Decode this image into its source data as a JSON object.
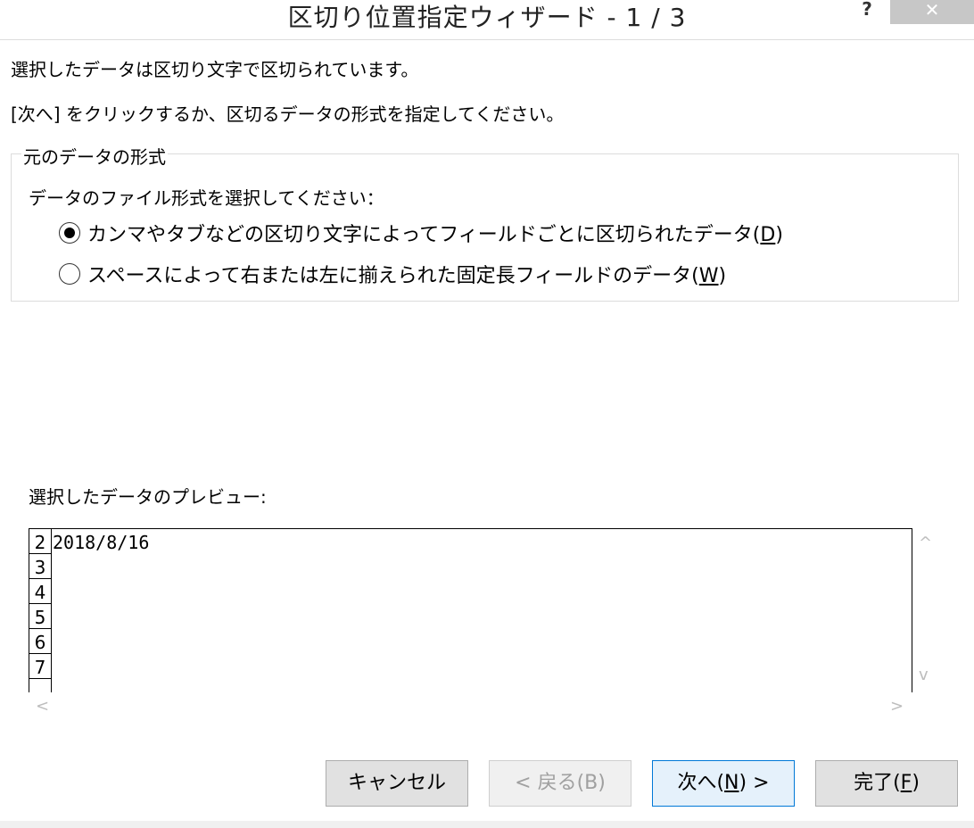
{
  "window": {
    "title": "区切り位置指定ウィザード - 1 / 3",
    "help_label": "?",
    "close_label": "✕"
  },
  "intro": {
    "line1": "選択したデータは区切り文字で区切られています。",
    "line2": "[次へ] をクリックするか、区切るデータの形式を指定してください。"
  },
  "format_group": {
    "legend": "元のデータの形式",
    "prompt": "データのファイル形式を選択してください：",
    "options": [
      {
        "label_pre": "カンマやタブなどの区切り文字によってフィールドごとに区切られたデータ(",
        "accel": "D",
        "label_post": ")",
        "selected": true
      },
      {
        "label_pre": "スペースによって右または左に揃えられた固定長フィールドのデータ(",
        "accel": "W",
        "label_post": ")",
        "selected": false
      }
    ]
  },
  "preview": {
    "label": "選択したデータのプレビュー:",
    "rows": [
      {
        "num": "2",
        "text": "2018/8/16"
      },
      {
        "num": "3",
        "text": ""
      },
      {
        "num": "4",
        "text": ""
      },
      {
        "num": "5",
        "text": ""
      },
      {
        "num": "6",
        "text": ""
      },
      {
        "num": "7",
        "text": ""
      }
    ]
  },
  "scroll": {
    "up": "^",
    "down": "v",
    "left": "<",
    "right": ">"
  },
  "buttons": {
    "cancel": "キャンセル",
    "back": "< 戻る(B)",
    "next_pre": "次へ(",
    "next_accel": "N",
    "next_post": ") >",
    "finish_pre": "完了(",
    "finish_accel": "F",
    "finish_post": ")"
  }
}
